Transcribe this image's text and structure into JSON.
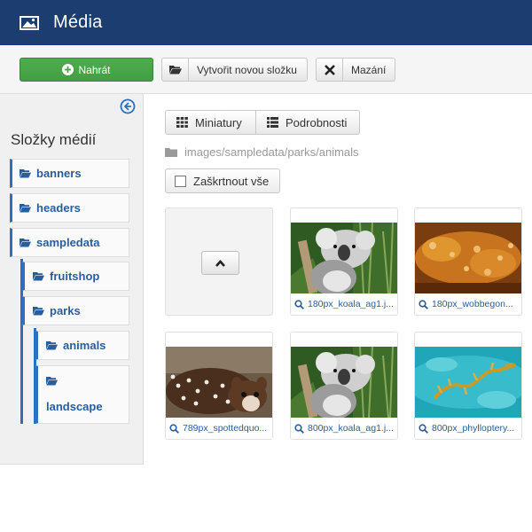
{
  "header": {
    "title": "Média",
    "icon": "image-icon"
  },
  "toolbar": {
    "upload_label": "Nahrát",
    "new_folder_label": "Vytvořit novou složku",
    "delete_label": "Mazání",
    "colors": {
      "upload": "#46a546",
      "header": "#1c3d6f"
    }
  },
  "sidebar": {
    "title": "Složky médií",
    "folders": [
      {
        "label": "banners"
      },
      {
        "label": "headers"
      },
      {
        "label": "sampledata"
      },
      {
        "label": "fruitshop"
      },
      {
        "label": "parks"
      },
      {
        "label": "animals"
      },
      {
        "label": "landscape"
      }
    ]
  },
  "view": {
    "thumbnails_label": "Miniatury",
    "details_label": "Podrobnosti"
  },
  "path": "images/sampledata/parks/animals",
  "check_all_label": "Zaškrtnout vše",
  "files": [
    {
      "name": "180px_koala_ag1.j...",
      "image": "koala"
    },
    {
      "name": "180px_wobbegon...",
      "image": "wobbegong"
    },
    {
      "name": "789px_spottedquo...",
      "image": "quoll"
    },
    {
      "name": "800px_koala_ag1.j...",
      "image": "koala"
    },
    {
      "name": "800px_phylloptery...",
      "image": "seadragon"
    }
  ]
}
